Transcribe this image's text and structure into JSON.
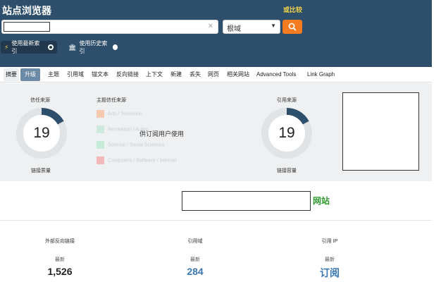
{
  "header": {
    "brand": "站点浏览器",
    "compare": "或比较",
    "scope_select": "根域",
    "index_new": "使用最新索引",
    "index_history": "使用历史索引"
  },
  "nav": {
    "tabs": [
      "摘要",
      "升级",
      "主题",
      "引用域",
      "锚文本",
      "反向链接",
      "上下文",
      "新建",
      "丢失",
      "网页",
      "相关网站",
      "Advanced Tools",
      "Link Graph"
    ]
  },
  "panel": {
    "trust_source": {
      "title": "信任来源",
      "value": "19",
      "caption": "链接质量",
      "fill_fraction": 0.17
    },
    "citation_source": {
      "title": "引用来源",
      "value": "19",
      "caption": "链接容量",
      "fill_fraction": 0.17
    },
    "topical": {
      "title": "主题信任来源",
      "topics": [
        {
          "label": "Arts / Television",
          "color": "#f6c9b1"
        },
        {
          "label": "Recreation / Autos",
          "color": "#cde9dc"
        },
        {
          "label": "Science / Social Sciences",
          "color": "#c6ecd9"
        },
        {
          "label": "Computers / Software / Internet",
          "color": "#f3b8b8"
        }
      ],
      "overlay": "供订阅用户使用"
    }
  },
  "site_label": "网站",
  "stats": [
    {
      "label": "外部反向链接",
      "sub": "最新",
      "value": "1,526",
      "color": "#222222"
    },
    {
      "label": "引用域",
      "sub": "最新",
      "value": "284",
      "color": "#3a78b0"
    },
    {
      "label": "引用 IP",
      "sub": "最新",
      "value": "订阅",
      "color": "#3a78b0"
    }
  ]
}
